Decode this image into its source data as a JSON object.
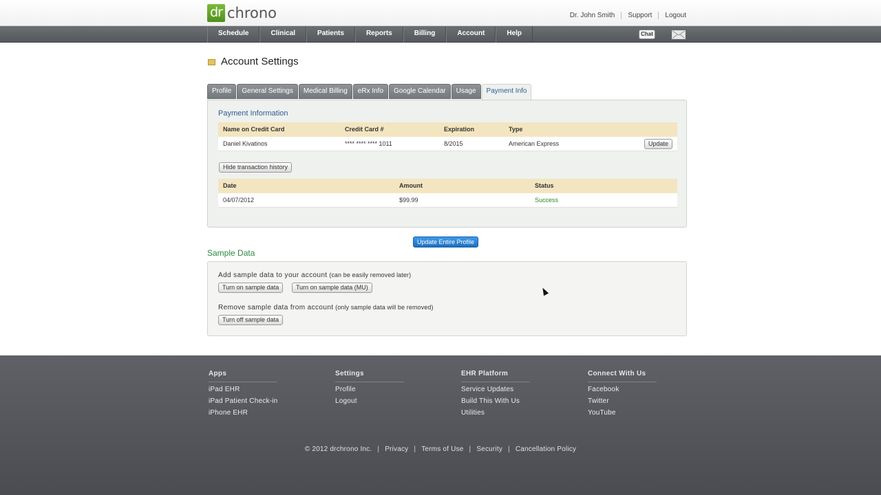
{
  "header": {
    "logo_badge": "dr",
    "logo_text": "chrono",
    "links": [
      "Dr. John Smith",
      "Support",
      "Logout"
    ]
  },
  "nav": {
    "items": [
      "Schedule",
      "Clinical",
      "Patients",
      "Reports",
      "Billing",
      "Account",
      "Help"
    ],
    "chat_label": "Chat"
  },
  "page": {
    "title": "Account Settings"
  },
  "tabs": [
    "Profile",
    "General Settings",
    "Medical Billing",
    "eRx Info",
    "Google Calendar",
    "Usage",
    "Payment Info"
  ],
  "payment": {
    "section_title": "Payment Information",
    "card_headers": [
      "Name on Credit Card",
      "Credit Card #",
      "Expiration",
      "Type"
    ],
    "card_row": {
      "name": "Daniel Kivatinos",
      "number": "**** **** **** 1011",
      "expiration": "8/2015",
      "type": "American Express"
    },
    "update_label": "Update",
    "hide_history_label": "Hide transaction history",
    "history_headers": [
      "Date",
      "Amount",
      "Status"
    ],
    "history_row": {
      "date": "04/07/2012",
      "amount": "$99.99",
      "status": "Success"
    }
  },
  "update_profile_label": "Update Entire Profile",
  "sample_data": {
    "title": "Sample Data",
    "add_text": "Add sample data to your account",
    "add_note": "(can be easily removed later)",
    "turn_on_label": "Turn on sample data",
    "turn_on_mu_label": "Turn on sample data (MU)",
    "remove_text": "Remove sample data from account",
    "remove_note": "(only sample data will be removed)",
    "turn_off_label": "Turn off sample data"
  },
  "footer": {
    "columns": [
      {
        "heading": "Apps",
        "links": [
          "iPad EHR",
          "iPad Patient Check-in",
          "iPhone EHR"
        ]
      },
      {
        "heading": "Settings",
        "links": [
          "Profile",
          "Logout"
        ]
      },
      {
        "heading": "EHR Platform",
        "links": [
          "Service Updates",
          "Build This With Us",
          "Utilities"
        ]
      },
      {
        "heading": "Connect With Us",
        "links": [
          "Facebook",
          "Twitter",
          "YouTube"
        ]
      }
    ],
    "copyright": "© 2012 drchrono Inc.",
    "legal_links": [
      "Privacy",
      "Terms of Use",
      "Security",
      "Cancellation Policy"
    ]
  },
  "colors": {
    "brand_green": "#5fa32a",
    "link_blue": "#2f5b9a",
    "success_green": "#2c8a1a",
    "table_header": "#f3e5c0",
    "primary_button": "#2a82d6"
  }
}
